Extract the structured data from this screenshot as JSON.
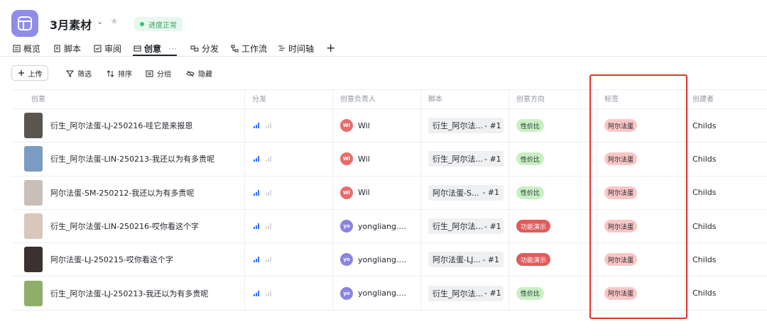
{
  "header": {
    "title": "3月素材",
    "status": "进度正常",
    "colors": {
      "app_icon": "#8f8de8",
      "status_dot": "#34c27a"
    }
  },
  "tabs": [
    {
      "label": "概览",
      "icon": "list-icon"
    },
    {
      "label": "脚本",
      "icon": "script-icon"
    },
    {
      "label": "审阅",
      "icon": "review-icon"
    },
    {
      "label": "创意",
      "icon": "creative-icon",
      "active": true,
      "more": "···"
    },
    {
      "label": "分发",
      "icon": "distribute-icon"
    },
    {
      "label": "工作流",
      "icon": "workflow-icon"
    },
    {
      "label": "时间轴",
      "icon": "timeline-icon"
    }
  ],
  "tab_add": "+",
  "toolbar": {
    "upload": "上传",
    "filter": "筛选",
    "sort": "排序",
    "group": "分组",
    "hide": "隐藏"
  },
  "table": {
    "columns": [
      "创意",
      "分发",
      "创意负责人",
      "脚本",
      "创意方向",
      "标签",
      "创建者"
    ],
    "rows": [
      {
        "name": "衍生_阿尔法蛋-LJ-250216-哇它是来报恩",
        "owner_initials": "Wi",
        "owner": "Wil",
        "owner_color": "#e86c6c",
        "script": "衍生_阿尔法...",
        "script_num": "- #1",
        "direction": "性价比",
        "direction_bg": "#c9f0c4",
        "direction_color": "#1f2329",
        "label": "阿尔法蛋",
        "creator": "Childs",
        "thumb_color": "#5b5550"
      },
      {
        "name": "衍生_阿尔法蛋-LIN-250213-我还以为有多贵呢",
        "owner_initials": "Wi",
        "owner": "Wil",
        "owner_color": "#e86c6c",
        "script": "衍生_阿尔法...",
        "script_num": "- #1",
        "direction": "性价比",
        "direction_bg": "#c9f0c4",
        "direction_color": "#1f2329",
        "label": "阿尔法蛋",
        "creator": "Childs",
        "thumb_color": "#7b9cc0"
      },
      {
        "name": "阿尔法蛋-SM-250212-我还以为有多贵呢",
        "owner_initials": "Wi",
        "owner": "Wil",
        "owner_color": "#e86c6c",
        "script": "阿尔法蛋-S...",
        "script_num": "- #1",
        "direction": "性价比",
        "direction_bg": "#c9f0c4",
        "direction_color": "#1f2329",
        "label": "阿尔法蛋",
        "creator": "Childs",
        "thumb_color": "#c9bfb8"
      },
      {
        "name": "衍生_阿尔法蛋-LIN-250216-哎你看这个字",
        "owner_initials": "yo",
        "owner": "yongliang....",
        "owner_color": "#8a84e0",
        "script": "衍生_阿尔法...",
        "script_num": "- #1",
        "direction": "功能演示",
        "direction_bg": "#e05c5c",
        "direction_color": "#ffffff",
        "label": "阿尔法蛋",
        "creator": "Childs",
        "thumb_color": "#d8c7bc"
      },
      {
        "name": "阿尔法蛋-LJ-250215-哎你看这个字",
        "owner_initials": "yo",
        "owner": "yongliang....",
        "owner_color": "#8a84e0",
        "script": "阿尔法蛋-LJ...",
        "script_num": "- #1",
        "direction": "功能演示",
        "direction_bg": "#e05c5c",
        "direction_color": "#ffffff",
        "label": "阿尔法蛋",
        "creator": "Childs",
        "thumb_color": "#3c3030"
      },
      {
        "name": "衍生_阿尔法蛋-LJ-250213-我还以为有多贵呢",
        "owner_initials": "yo",
        "owner": "yongliang....",
        "owner_color": "#8a84e0",
        "script": "衍生_阿尔法...",
        "script_num": "- #1",
        "direction": "性价比",
        "direction_bg": "#c9f0c4",
        "direction_color": "#1f2329",
        "label": "阿尔法蛋",
        "creator": "Childs",
        "thumb_color": "#8fae6a"
      }
    ]
  },
  "annotation": {
    "color": "#e5322d"
  }
}
